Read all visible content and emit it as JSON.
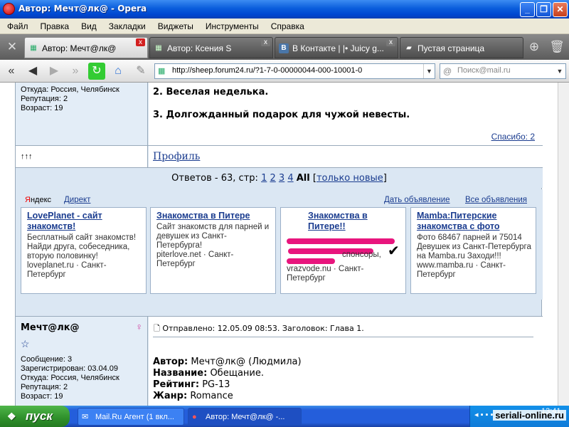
{
  "window": {
    "title": "Автор: Мечт@лк@ - Opera",
    "controls": {
      "minimize": "_",
      "maximize": "❐",
      "close": "✕"
    }
  },
  "menu": [
    "Файл",
    "Правка",
    "Вид",
    "Закладки",
    "Виджеты",
    "Инструменты",
    "Справка"
  ],
  "tabs": [
    {
      "label": "Автор: Мечт@лк@",
      "icon": "forum-favicon",
      "active": true
    },
    {
      "label": "Автор: Ксения S",
      "icon": "forum-favicon",
      "active": false
    },
    {
      "label": "В Контакте | |• Juicy g...",
      "icon": "vk-favicon",
      "active": false
    },
    {
      "label": "Пустая страница",
      "icon": "blank-page-icon",
      "active": false
    }
  ],
  "nav": {
    "url": "http://sheep.forum24.ru/?1-7-0-00000044-000-10001-0",
    "search_placeholder": "Поиск@mail.ru"
  },
  "post1": {
    "profile_lines": [
      "Откуда: Россия, Челябинск",
      "Репутация: 2",
      "Возраст: 19"
    ],
    "list_item_2": "2. Веселая неделька.",
    "list_item_3": "3. Долгожданный подарок для чужой невесты.",
    "thanks": "Спасибо: 2",
    "arrows": "↑↑↑",
    "profile_link": "Профиль"
  },
  "pager": {
    "prefix": "Ответов - 63, стр:",
    "pages": [
      "1",
      "2",
      "3",
      "4"
    ],
    "current": "All",
    "new_only": "только новые"
  },
  "ads": {
    "brand_y": "Я",
    "brand_rest": "ндекс",
    "direct": "Директ",
    "post_ad": "Дать объявление",
    "all_ads": "Все объявления",
    "items": [
      {
        "title": "LovePlanet - сайт знакомств!",
        "body": "Бесплатный сайт знакомств! Найди друга, собеседника, вторую половинку!",
        "url": "loveplanet.ru",
        "city": "Санкт-Петербург"
      },
      {
        "title": "Знакомства в Питере",
        "body": "Сайт знакомств для парней и девушек из Санкт-Петербурга!",
        "url": "piterlove.net",
        "city": "Санкт-Петербург"
      },
      {
        "title": "Знакомства в Питере!!",
        "body": "спонсоры,",
        "url": "vrazvode.nu",
        "city": "Санкт-Петербург"
      },
      {
        "title": "Mamba:Питерские знакомства с фото",
        "body": "Фото 68467 парней и 75014 Девушек из Санкт-Петербурга на Mamba.ru Заходи!!!",
        "url": "www.mamba.ru",
        "city": "Санкт-Петербург"
      }
    ]
  },
  "post2": {
    "author": "Мечт@лк@",
    "gender_symbol": "♀",
    "rank_symbol": "☆",
    "profile_lines": [
      "Сообщение: 3",
      "Зарегистрирован: 03.04.09",
      "Откуда: Россия, Челябинск",
      "Репутация: 2",
      "Возраст: 19"
    ],
    "header": "Отправлено: 12.05.09 08:53. Заголовок: Глава 1.",
    "fields": [
      {
        "label": "Автор:",
        "value": "Мечт@лк@ (Людмила)"
      },
      {
        "label": "Название:",
        "value": "Обещание."
      },
      {
        "label": "Рейтинг:",
        "value": "PG-13"
      },
      {
        "label": "Жанр:",
        "value": "Romance"
      }
    ]
  },
  "taskbar": {
    "start": "пуск",
    "items": [
      {
        "label": "Mail.Ru Агент (1 вкл...",
        "active": false
      },
      {
        "label": "Автор: Мечт@лк@ -...",
        "active": true
      }
    ],
    "clock": "13:41",
    "watermark": "seriali-online.ru"
  },
  "colors": {
    "link": "#1a3c8f",
    "forum_bg": "#dbe7f3",
    "scribble": "#e8157d"
  }
}
